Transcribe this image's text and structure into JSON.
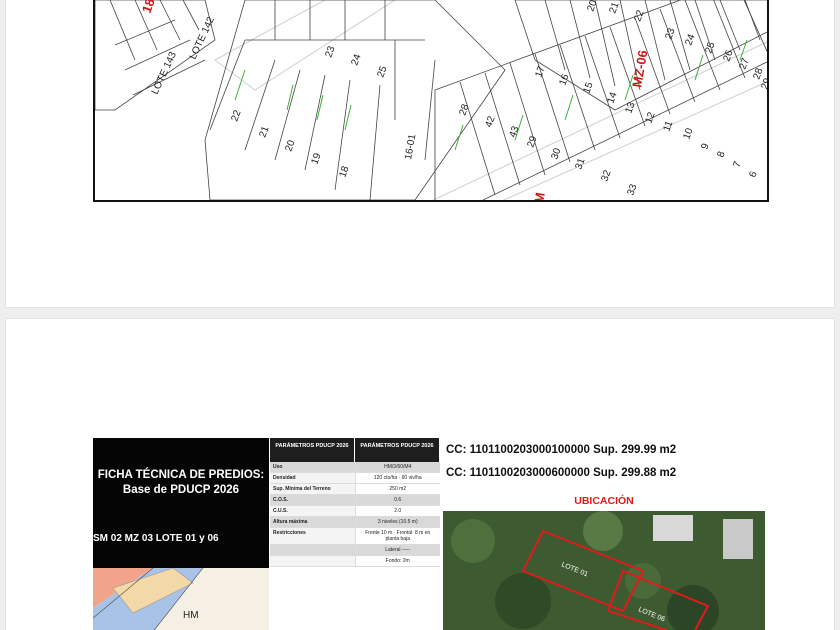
{
  "plan": {
    "manzana_right": "MZ-06",
    "manzana_bottom": "M",
    "manzana_left": "18",
    "lots_top": [
      "23",
      "24",
      "25",
      "22",
      "21",
      "20",
      "19",
      "18",
      "16-01",
      "28",
      "42",
      "43",
      "29",
      "30",
      "31",
      "32",
      "33"
    ],
    "lots_right": [
      "17",
      "16",
      "15",
      "14",
      "13",
      "12",
      "11",
      "10",
      "9",
      "8",
      "7",
      "6",
      "5",
      "4",
      "20",
      "21",
      "22",
      "23",
      "24",
      "25",
      "26",
      "27",
      "28",
      "29"
    ],
    "lot_left_label": "LOTE 143",
    "lot_left_label2": "LOTE 142"
  },
  "ficha": {
    "title_line1": "FICHA TÉCNICA DE PREDIOS:",
    "title_line2": "Base de PDUCP 2026",
    "subtitle": "SM 02 MZ 03 LOTE 01 y 06",
    "mini_map_label": "HM",
    "table_head_1": "PARÁMETROS PDUCP 2026",
    "table_head_2": "PARÁMETROS PDUCP 2026",
    "rows": [
      {
        "k": "Uso",
        "v": "HM/3/60/M4",
        "gray": true
      },
      {
        "k": "Densidad",
        "v": "120 cto/ha · 60 viv/ha",
        "gray": false
      },
      {
        "k": "Sup. Mínima del Terreno",
        "v": "250 m2",
        "gray": false
      },
      {
        "k": "C.O.S.",
        "v": "0.6",
        "gray": true
      },
      {
        "k": "C.U.S.",
        "v": "2.0",
        "gray": false
      },
      {
        "k": "Altura máxima",
        "v": "3 niveles (10.5 m)",
        "gray": true
      },
      {
        "k": "Restricciones",
        "v": "Frente 10 m · Frontal: 8 m en planta baja",
        "gray": false
      },
      {
        "k": "",
        "v": "Lateral -----",
        "gray": true
      },
      {
        "k": "",
        "v": "Fondo: 2m",
        "gray": false
      }
    ],
    "cc1": "CC: 1101100203000100000  Sup. 299.99 m2",
    "cc2": "CC: 1101100203000600000  Sup. 299.88 m2",
    "ubicacion": "UBICACIÓN",
    "aerial_lot1": "LOTE 01",
    "aerial_lot2": "LOTE 06"
  }
}
